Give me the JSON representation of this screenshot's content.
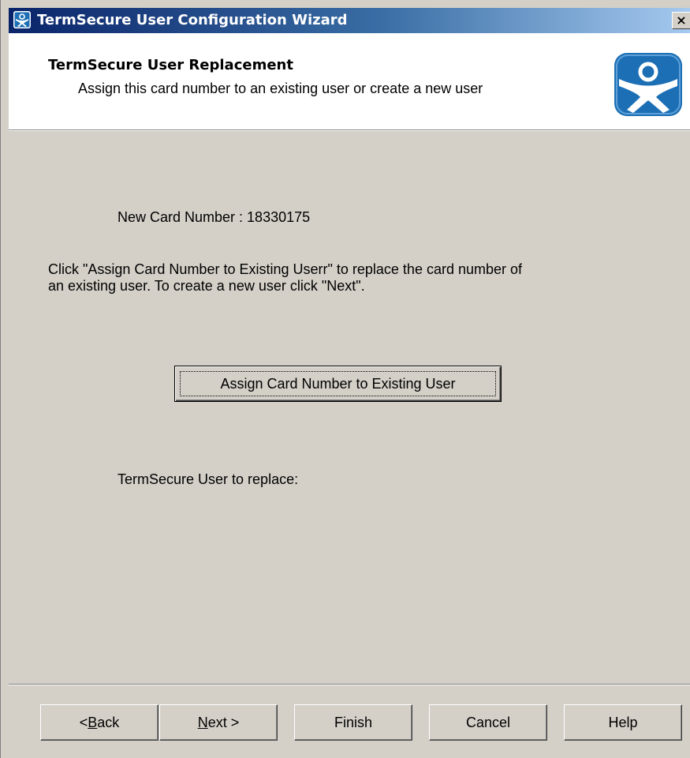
{
  "window": {
    "title": "TermSecure User Configuration Wizard",
    "close_glyph": "×",
    "icon": "thinmanager-icon"
  },
  "header": {
    "title": "TermSecure User Replacement",
    "subtitle": "Assign this card number to an existing user or create a new user",
    "logo": "thinmanager-logo"
  },
  "content": {
    "card_number_text": "New Card Number : 18330175",
    "instruction_line1": "Click \"Assign Card Number to Existing Userr\" to replace the card number  of",
    "instruction_line2": "an existing user. To create a new user click \"Next\".",
    "assign_button_label": "Assign Card Number to Existing User",
    "user_to_replace_label": "TermSecure User to replace:"
  },
  "buttons": {
    "back": {
      "prefix": "< ",
      "mnemonic": "B",
      "rest": "ack"
    },
    "next": {
      "mnemonic": "N",
      "rest": "ext >"
    },
    "finish": "Finish",
    "cancel": "Cancel",
    "help": "Help"
  },
  "colors": {
    "title_start": "#0a246a",
    "title_end": "#a6caf0",
    "face": "#d4d0c8",
    "logo_blue": "#1c6fb5"
  }
}
